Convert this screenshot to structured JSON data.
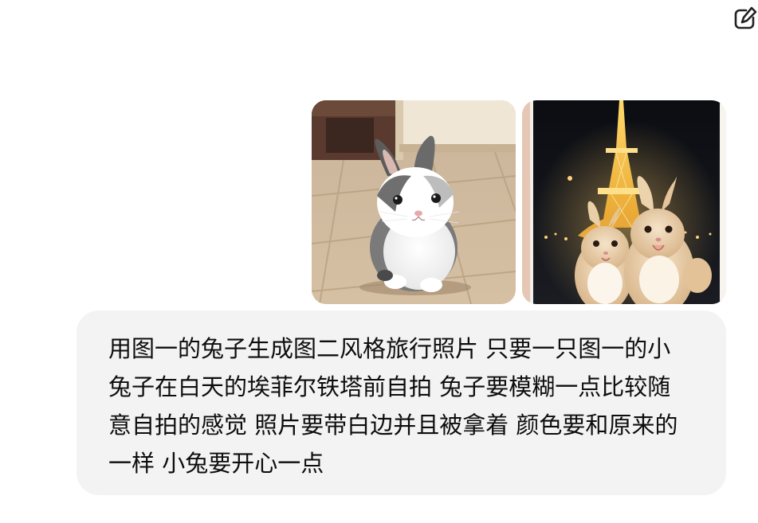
{
  "header": {
    "edit_icon": "edit-pencil-icon"
  },
  "message": {
    "role": "user",
    "attachments": [
      {
        "icon": "photo-rabbit-on-tile-floor",
        "description_hidden": ""
      },
      {
        "icon": "photo-rabbits-eiffel-tower-night",
        "description_hidden": ""
      }
    ],
    "text": "用图一的兔子生成图二风格旅行照片 只要一只图一的小兔子在白天的埃菲尔铁塔前自拍 兔子要模糊一点比较随意自拍的感觉 照片要带白边并且被拿着 颜色要和原来的一样 小兔要开心一点"
  },
  "colors": {
    "bubble_background": "#f3f3f3",
    "text": "#0d0d0d",
    "page_background": "#ffffff"
  }
}
